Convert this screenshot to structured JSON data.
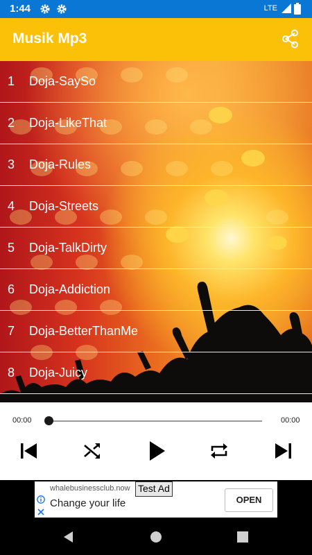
{
  "status_bar": {
    "time": "1:44",
    "network": "LTE"
  },
  "app_bar": {
    "title": "Musik Mp3"
  },
  "tracks": [
    {
      "num": "1",
      "title": "Doja-SaySo"
    },
    {
      "num": "2",
      "title": "Doja-LikeThat"
    },
    {
      "num": "3",
      "title": "Doja-Rules"
    },
    {
      "num": "4",
      "title": "Doja-Streets"
    },
    {
      "num": "5",
      "title": "Doja-TalkDirty"
    },
    {
      "num": "6",
      "title": "Doja-Addiction"
    },
    {
      "num": "7",
      "title": "Doja-BetterThanMe"
    },
    {
      "num": "8",
      "title": "Doja-Juicy"
    }
  ],
  "player": {
    "current_time": "00:00",
    "total_time": "00:00",
    "progress": 0
  },
  "ad": {
    "url": "whalebusinessclub.now",
    "tag": "Test Ad",
    "headline": "Change your life",
    "cta": "OPEN"
  },
  "colors": {
    "status_bar": "#0a77d4",
    "app_bar": "#fbc108",
    "divider": "#e9e9e9"
  },
  "icons": {
    "app_bar": [
      "share-icon"
    ],
    "player": [
      "previous-icon",
      "shuffle-icon",
      "play-icon",
      "repeat-icon",
      "next-icon"
    ],
    "nav": [
      "back-icon",
      "home-icon",
      "recents-icon"
    ]
  }
}
